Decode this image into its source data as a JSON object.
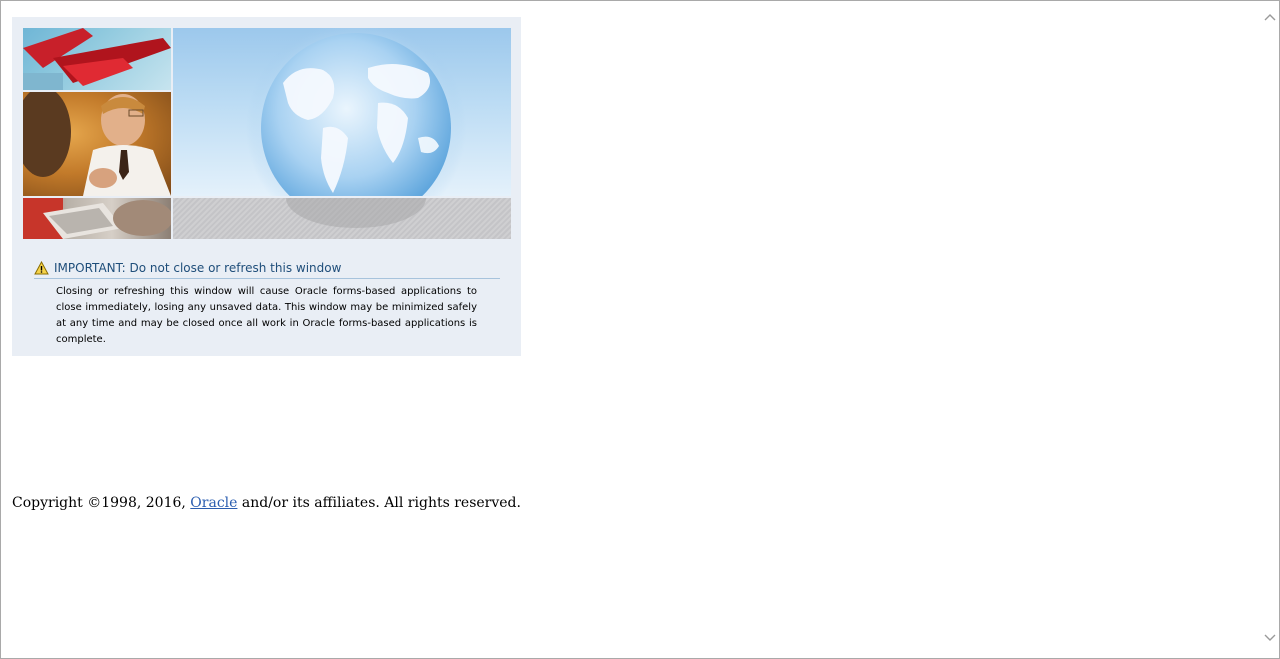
{
  "notice": {
    "heading": "IMPORTANT: Do not close or refresh this window",
    "body": "Closing or refreshing this window will cause Oracle forms-based applications to close immediately, losing any unsaved data. This window may be minimized safely at any time and may be closed once all work in Oracle forms-based applications is complete.",
    "icon": "warning-icon"
  },
  "banner": {
    "images": [
      "plane-photo",
      "businessman-photo",
      "laptop-photo",
      "globe-image"
    ]
  },
  "footer": {
    "copyright_prefix": "Copyright ©1998, 2016, ",
    "link_text": "Oracle",
    "copyright_suffix": " and/or its affiliates. All rights reserved."
  },
  "colors": {
    "panel_bg": "#e9eef5",
    "heading": "#1f4e7a",
    "link": "#2a5db0"
  }
}
